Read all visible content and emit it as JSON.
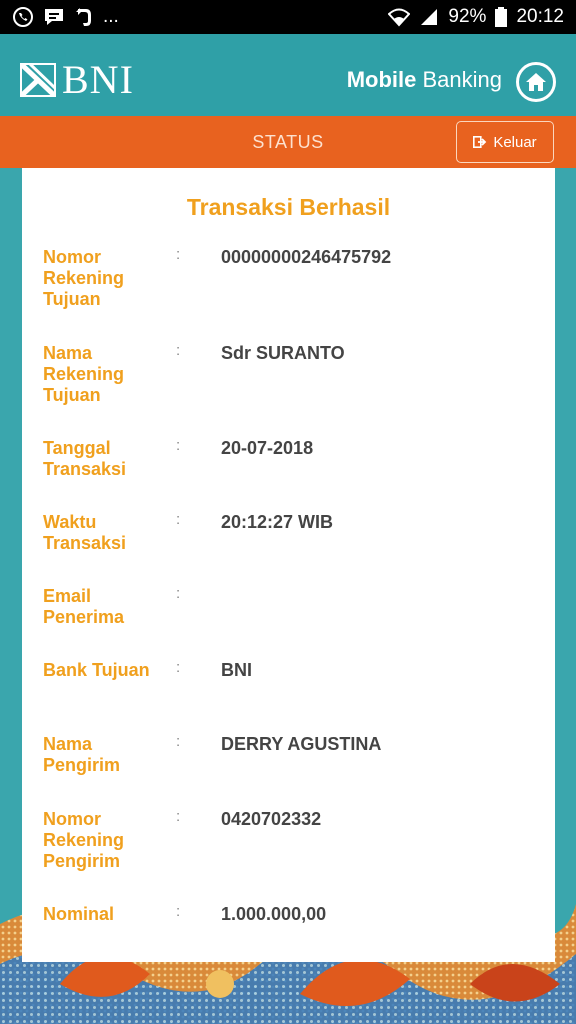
{
  "status_bar": {
    "icons_left": [
      "whatsapp-icon",
      "chat-icon",
      "evernote-icon"
    ],
    "more": "...",
    "battery_pct": "92%",
    "time": "20:12"
  },
  "header": {
    "logo_text": "BNI",
    "title_bold": "Mobile",
    "title_rest": " Banking",
    "home_icon": "home-icon"
  },
  "toolbar": {
    "title": "STATUS",
    "logout_label": "Keluar"
  },
  "card": {
    "title": "Transaksi Berhasil",
    "fields": [
      {
        "label": "Nomor Rekening Tujuan",
        "value": "00000000246475792"
      },
      {
        "label": "Nama Rekening Tujuan",
        "value": "Sdr SURANTO"
      },
      {
        "label": "Tanggal Transaksi",
        "value": "20-07-2018"
      },
      {
        "label": "Waktu Transaksi",
        "value": "20:12:27 WIB"
      },
      {
        "label": "Email Penerima",
        "value": ""
      },
      {
        "label": "Bank Tujuan",
        "value": "BNI"
      },
      {
        "label": "Nama Pengirim",
        "value": "DERRY AGUSTINA"
      },
      {
        "label": "Nomor Rekening Pengirim",
        "value": "0420702332"
      },
      {
        "label": "Nominal",
        "value": "1.000.000,00"
      }
    ]
  },
  "colors": {
    "teal": "#2fa0a7",
    "orange": "#e8621f",
    "label_orange": "#f0a01e"
  }
}
